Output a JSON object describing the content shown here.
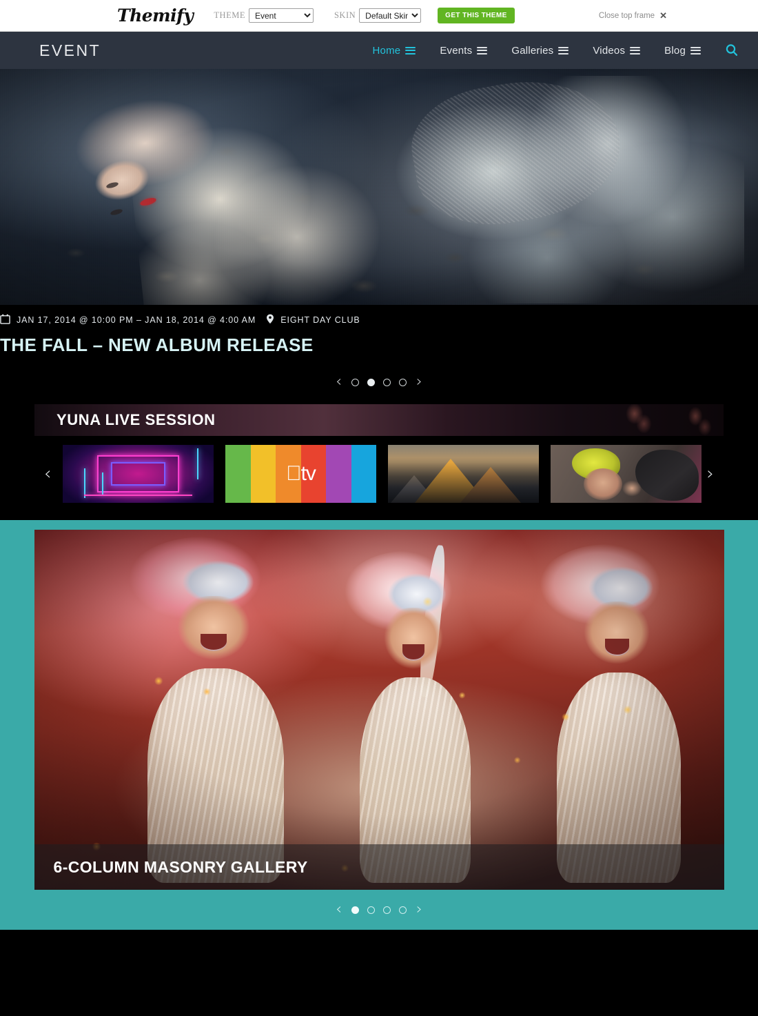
{
  "topframe": {
    "logo": "Themify",
    "theme_label": "THEME",
    "theme_value": "Event",
    "theme_options": [
      "Event"
    ],
    "skin_label": "SKIN",
    "skin_value": "Default Skin",
    "skin_options": [
      "Default Skin"
    ],
    "cta_label": "GET THIS THEME",
    "cta_color": "#61b522",
    "close_label": "Close top frame",
    "close_icon": "close-x-icon"
  },
  "nav": {
    "brand": "EVENT",
    "accent_color": "#22c3dc",
    "background_color": "#2d3440",
    "items": [
      {
        "label": "Home",
        "active": true,
        "icon": "submenu-bars-icon"
      },
      {
        "label": "Events",
        "active": false,
        "icon": "submenu-bars-icon"
      },
      {
        "label": "Galleries",
        "active": false,
        "icon": "submenu-bars-icon"
      },
      {
        "label": "Videos",
        "active": false,
        "icon": "submenu-bars-icon"
      },
      {
        "label": "Blog",
        "active": false,
        "icon": "submenu-bars-icon"
      }
    ],
    "search_icon": "search-icon"
  },
  "hero": {
    "alt": "fashion model in white gown lying on dark leaves"
  },
  "event": {
    "date_icon": "calendar-icon",
    "date_text": "JAN 17, 2014 @ 10:00 PM – JAN 18, 2014 @ 4:00 AM",
    "location_icon": "map-pin-icon",
    "location_text": "EIGHT DAY CLUB",
    "title": "THE FALL – NEW ALBUM RELEASE"
  },
  "event_slider": {
    "prev_icon": "chevron-left-icon",
    "next_icon": "chevron-right-icon",
    "total": 4,
    "active_index": 1
  },
  "filmstrip": {
    "banner_title": "YUNA LIVE SESSION",
    "prev_icon": "chevron-left-icon",
    "next_icon": "chevron-right-icon",
    "thumbnails": [
      {
        "name": "neon-tunnel-thumbnail",
        "alt": "magenta and blue neon light tunnel"
      },
      {
        "name": "apple-tv-thumbnail",
        "alt": "Apple TV rainbow stripe logo",
        "logo_text": "tv"
      },
      {
        "name": "mountain-thumbnail",
        "alt": "golden sunlit mountain peak at sunset"
      },
      {
        "name": "yuna-portrait-thumbnail",
        "alt": "woman wearing a yellow turban"
      }
    ]
  },
  "gallery": {
    "caption": "6-COLUMN MASONRY GALLERY",
    "alt": "three cabaret showgirls with feathered headdresses cheering",
    "background_color": "#3aaaa8"
  },
  "gallery_slider": {
    "prev_icon": "chevron-left-icon",
    "next_icon": "chevron-right-icon",
    "total": 4,
    "active_index": 0
  }
}
